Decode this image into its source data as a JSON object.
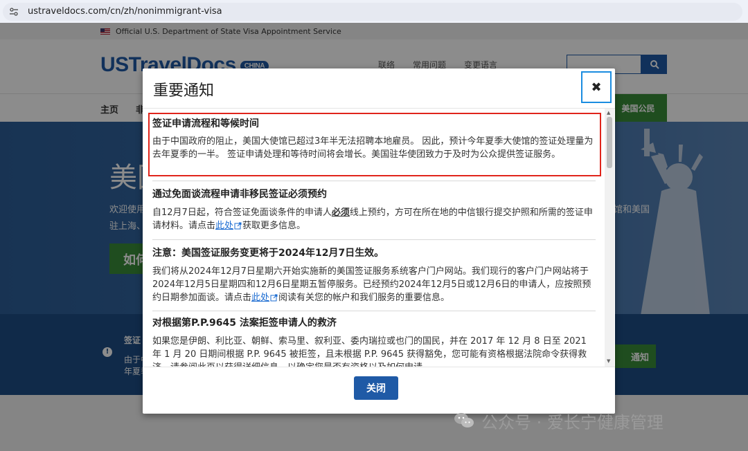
{
  "browser": {
    "url": "ustraveldocs.com/cn/zh/nonimmigrant-visa"
  },
  "page": {
    "gov_strip": "Official U.S. Department of State Visa Appointment Service",
    "logo": "USTravelDocs",
    "logo_badge": "CHINA",
    "top_links": [
      "联络",
      "常用问题",
      "变更语言"
    ],
    "nav_home": "主页",
    "nav_partial": "非",
    "nav_citizen": "美国公民",
    "hero_title": "美国",
    "hero_text1": "欢迎使用",
    "hero_text2": "驻上海、",
    "hero_right": "馆和美国",
    "hero_button": "如何",
    "notice_title": "签证",
    "notice_line1": "由于中",
    "notice_line2": "年夏季",
    "notice_button": "通知"
  },
  "modal": {
    "title": "重要通知",
    "close_button": "关闭",
    "sections": [
      {
        "title": "签证申请流程和等候时间",
        "text": "由于中国政府的阻止，美国大使馆已超过3年半无法招聘本地雇员。 因此，预计今年夏季大使馆的签证处理量为去年夏季的一半。 签证申请处理和等待时间将会增长。美国驻华使团致力于及时为公众提供签证服务。"
      },
      {
        "title": "通过免面谈流程申请非移民签证必须预约",
        "text_before": "自12月7日起，符合签证免面谈条件的申请人",
        "text_bold": "必须",
        "text_middle": "线上预约，方可在所在地的中信银行提交护照和所需的签证申请材料。请点击",
        "link": "此处",
        "text_after": "获取更多信息。"
      },
      {
        "title": "注意：美国签证服务变更将于2024年12月7日生效。",
        "text_before": "我们将从2024年12月7日星期六开始实施新的美国签证服务系统客户门户网站。我们现行的客户门户网站将于2024年12月5日星期四和12月6日星期五暂停服务。已经预约2024年12月5日或12月6日的申请人，应按照预约日期参加面谈。请点击",
        "link": "此处",
        "text_after": "阅读有关您的帐户和我们服务的重要信息。"
      },
      {
        "title": "对根据第P.P.9645 法案拒签申请人的救济",
        "text": "如果您是伊朗、利比亚、朝鲜、索马里、叙利亚、委内瑞拉或也门的国民，并在 2017 年 12 月 8 日至 2021 年 1 月 20 日期间根据 P.P. 9645 被拒签，且未根据 P.P. 9645 获得豁免，您可能有资格根据法院命令获得救济。请参阅此页以获得详细信息，以确定您是否有资格以及如何申请。"
      }
    ]
  },
  "watermark": "公众号 · 爱长宁健康管理",
  "colors": {
    "brand_blue": "#1f5aa6",
    "highlight_red": "#e0241b",
    "focus_blue": "#1a8ce0",
    "green": "#3a8c3a"
  }
}
